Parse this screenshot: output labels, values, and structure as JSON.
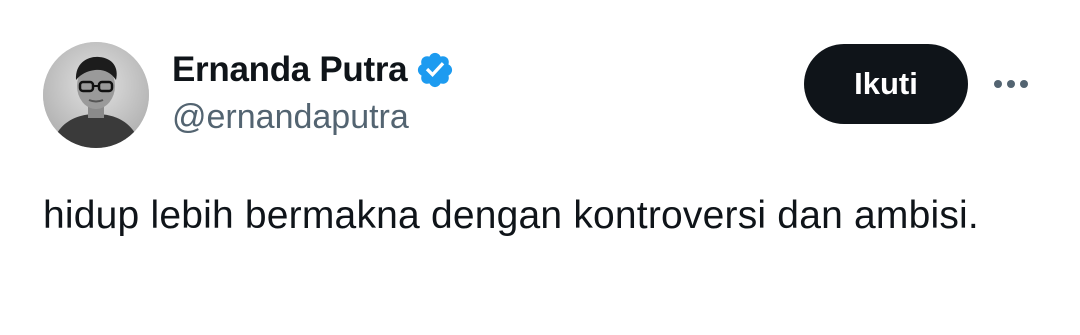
{
  "author": {
    "display_name": "Ernanda Putra",
    "handle": "@ernandaputra",
    "verified": true,
    "avatar_icon": "profile-photo"
  },
  "actions": {
    "follow_label": "Ikuti",
    "more_icon": "more-horizontal-icon"
  },
  "tweet": {
    "text": "hidup lebih bermakna dengan kontroversi dan ambisi."
  },
  "colors": {
    "text_primary": "#0f1419",
    "text_secondary": "#536471",
    "verified_blue": "#1d9bf0",
    "follow_button_bg": "#0f1419",
    "background": "#ffffff"
  }
}
